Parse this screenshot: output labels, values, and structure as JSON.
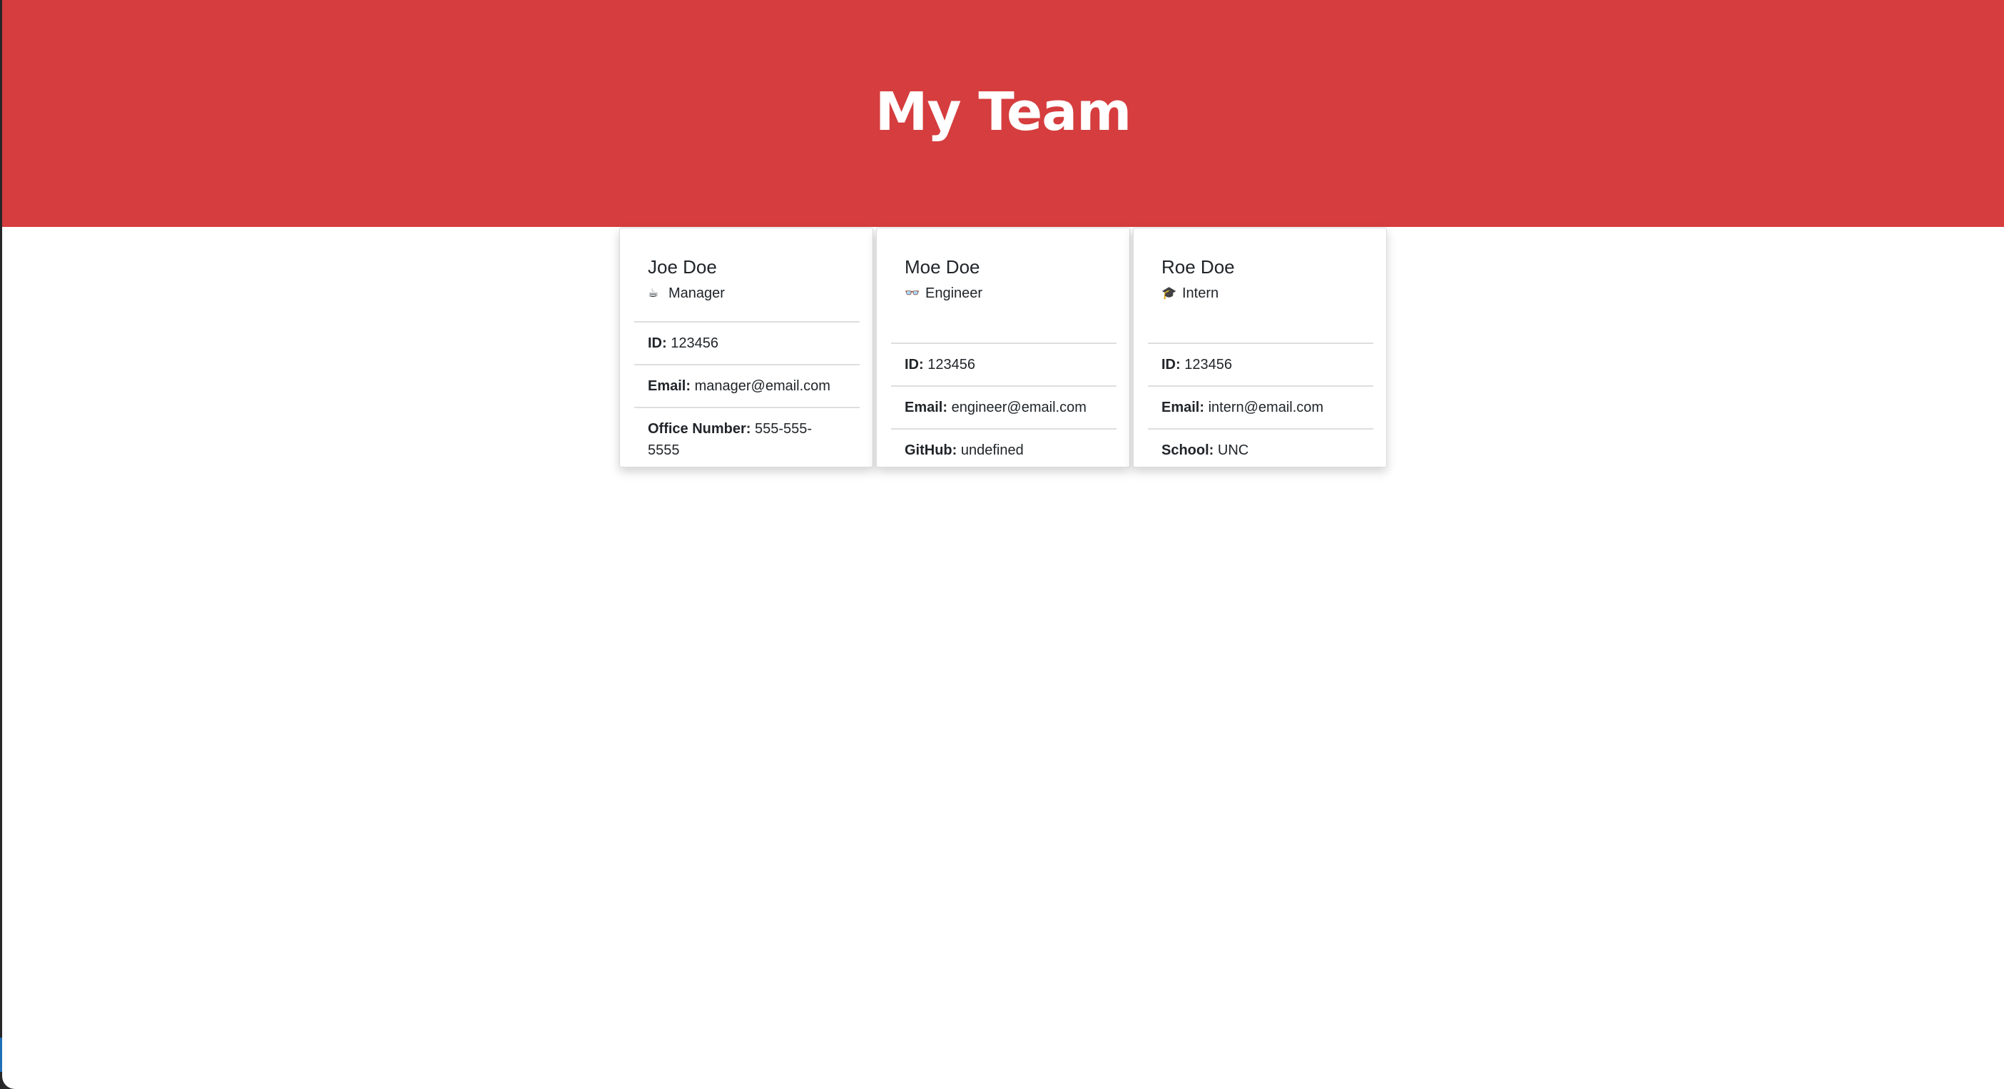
{
  "header": {
    "title": "My Team"
  },
  "colors": {
    "header_bg": "#d63d3e",
    "header_text": "#ffffff",
    "text": "#212529",
    "divider": "#dedede"
  },
  "team": [
    {
      "name": "Joe Doe",
      "role": "Manager",
      "icon": "hot-beverage-icon",
      "icon_glyph": "☕",
      "details": [
        {
          "label": "ID:",
          "value": "123456"
        },
        {
          "label": "Email:",
          "value": "manager@email.com"
        },
        {
          "label": "Office Number:",
          "value": "555-555-5555"
        }
      ]
    },
    {
      "name": "Moe Doe",
      "role": "Engineer",
      "icon": "glasses-icon",
      "icon_glyph": "👓",
      "details": [
        {
          "label": "ID:",
          "value": "123456"
        },
        {
          "label": "Email:",
          "value": "engineer@email.com"
        },
        {
          "label": "GitHub:",
          "value": "undefined"
        }
      ]
    },
    {
      "name": "Roe Doe",
      "role": "Intern",
      "icon": "graduation-cap-icon",
      "icon_glyph": "🎓",
      "details": [
        {
          "label": "ID:",
          "value": "123456"
        },
        {
          "label": "Email:",
          "value": "intern@email.com"
        },
        {
          "label": "School:",
          "value": "UNC"
        }
      ]
    }
  ]
}
